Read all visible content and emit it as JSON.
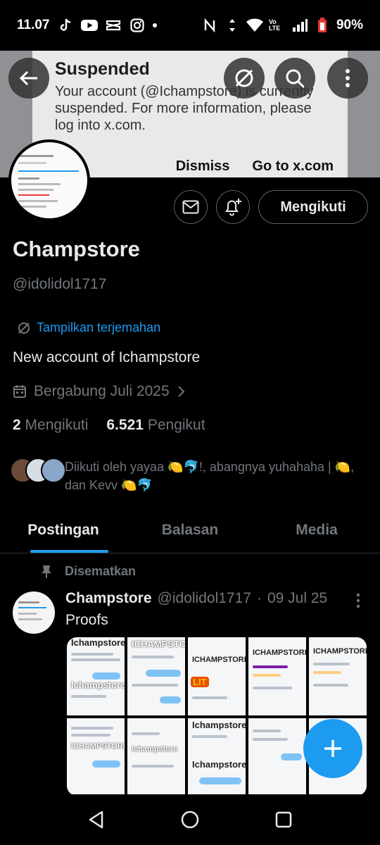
{
  "status_bar": {
    "time": "11.07",
    "battery": "90%",
    "icons": [
      "tiktok-icon",
      "youtube-icon",
      "capcut-icon",
      "instagram-icon",
      "nfc-icon",
      "data-arrows-icon",
      "wifi-icon",
      "volte-icon",
      "signal-icon",
      "battery-icon"
    ],
    "network_label": "Vo LTE"
  },
  "banner": {
    "title": "Suspended",
    "body": "Your account (@Ichampstore) is currently suspended. For more information, please log into x.com.",
    "dismiss": "Dismiss",
    "goto": "Go to x.com"
  },
  "profile": {
    "name": "Champstore",
    "handle": "@idolidol1717",
    "translate": "Tampilkan terjemahan",
    "bio": "New account of Ichampstore",
    "joined": "Bergabung Juli 2025",
    "following_count": "2",
    "following_label": "Mengikuti",
    "followers_count": "6.521",
    "followers_label": "Pengikut",
    "followed_by": "Diikuti oleh yayaa 🍋🐬!, abangnya yuhahaha | 🍋, dan Kevv 🍋🐬",
    "follow_button": "Mengikuti"
  },
  "tabs": [
    {
      "label": "Postingan",
      "active": true
    },
    {
      "label": "Balasan",
      "active": false
    },
    {
      "label": "Media",
      "active": false
    }
  ],
  "post": {
    "pinned_label": "Disematkan",
    "author": "Champstore",
    "handle": "@idolidol1717",
    "separator": "·",
    "date": "09 Jul 25",
    "text": "Proofs",
    "watermarks": [
      "Ichampstore",
      "Ichampstore",
      "ICHAMPSTORE",
      "ICHAMPSTORE",
      "ICHAMPSTORE",
      "ICHAMPSTORE",
      "ICHAMPSTORE",
      "Ichampstore",
      "Ichampstore",
      "Ichampstore"
    ],
    "lit_label": "LIT"
  },
  "colors": {
    "accent": "#1d9bf0",
    "background": "#000000",
    "muted": "#71767b",
    "text": "#e7e9ea"
  }
}
